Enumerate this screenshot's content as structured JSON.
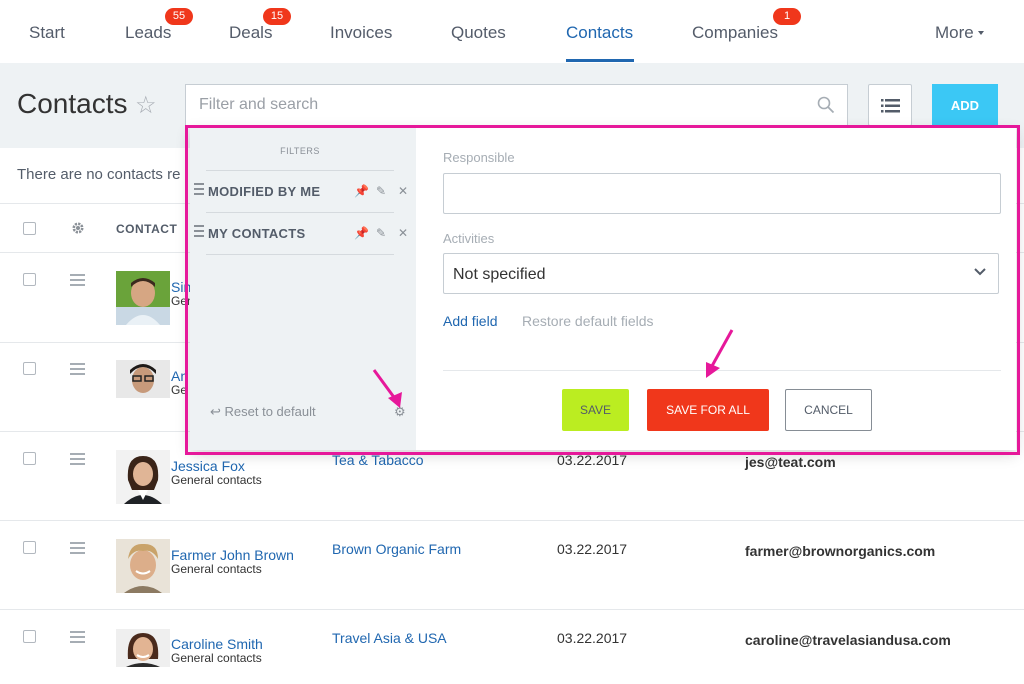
{
  "nav": {
    "items": [
      {
        "label": "Start"
      },
      {
        "label": "Leads",
        "badge": "55"
      },
      {
        "label": "Deals",
        "badge": "15"
      },
      {
        "label": "Invoices"
      },
      {
        "label": "Quotes"
      },
      {
        "label": "Contacts"
      },
      {
        "label": "Companies",
        "badge": "1"
      }
    ],
    "more_label": "More",
    "active": "Contacts"
  },
  "header": {
    "title": "Contacts",
    "star_icon": "star-icon",
    "search_placeholder": "Filter and search",
    "add_label": "ADD"
  },
  "notice": "There are no contacts re",
  "table": {
    "columns": [
      "CONTACT"
    ],
    "rows": [
      {
        "name": "Sin",
        "group": "Gene",
        "company": "",
        "date": "",
        "email": ""
      },
      {
        "name": "An",
        "group": "Ge",
        "company": "",
        "date": "",
        "email": ""
      },
      {
        "name": "Jessica Fox",
        "group": "General contacts",
        "company": "Tea & Tabacco",
        "date": "03.22.2017",
        "email": "jes@teat.com"
      },
      {
        "name": "Farmer John Brown",
        "group": "General contacts",
        "company": "Brown Organic Farm",
        "date": "03.22.2017",
        "email": "farmer@brownorganics.com"
      },
      {
        "name": "Caroline Smith",
        "group": "General contacts",
        "company": "Travel Asia & USA",
        "date": "03.22.2017",
        "email": "caroline@travelasiandusa.com"
      }
    ]
  },
  "filter_popup": {
    "filters_label": "FILTERS",
    "presets": [
      {
        "label": "MODIFIED BY ME"
      },
      {
        "label": "MY CONTACTS"
      }
    ],
    "reset_label": "Reset to default",
    "responsible_label": "Responsible",
    "responsible_value": "",
    "activities_label": "Activities",
    "activities_value": "Not specified",
    "add_field_label": "Add field",
    "restore_label": "Restore default fields",
    "save_label": "SAVE",
    "save_all_label": "SAVE FOR ALL",
    "cancel_label": "CANCEL"
  },
  "colors": {
    "accent": "#2067b0",
    "badge": "#f0371b",
    "add_button": "#3bc8f5",
    "save_button": "#bbed21",
    "save_all_button": "#f0371b",
    "highlight": "#e6189a"
  }
}
